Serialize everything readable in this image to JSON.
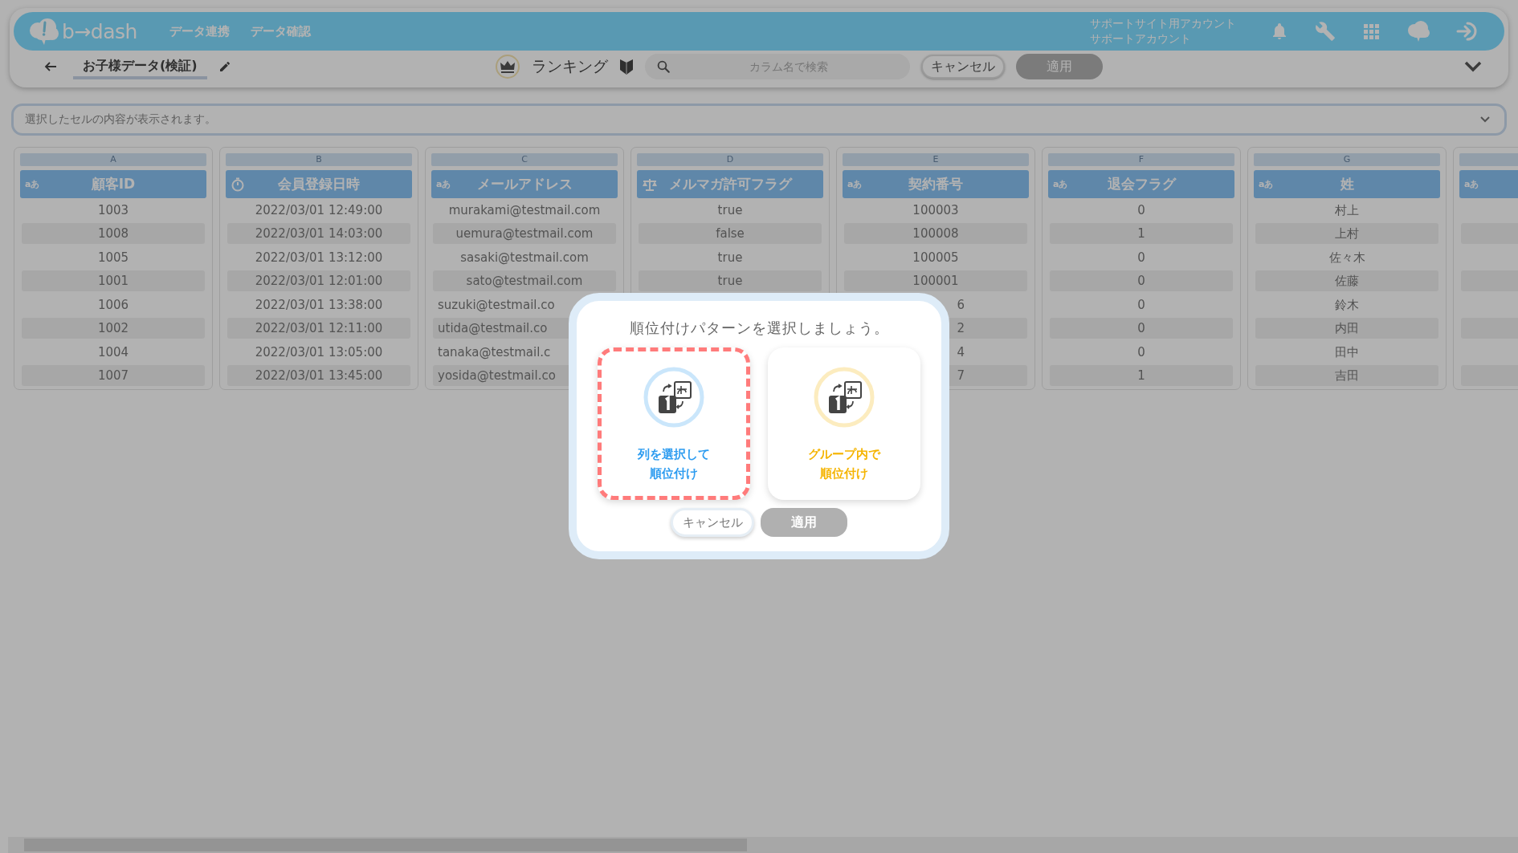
{
  "header": {
    "logo": "b→dash",
    "nav": [
      "データ連携",
      "データ確認"
    ],
    "account": [
      "サポートサイト用アカウント",
      "サポートアカウント"
    ]
  },
  "toolbar": {
    "title": "お子様データ(検証)",
    "mode": "ランキング",
    "search": {
      "placeholder": "カラム名で検索"
    },
    "cancel": "キャンセル",
    "apply": {
      "label": "適用",
      "disabled": true
    }
  },
  "cell_viewer": {
    "placeholder": "選択したセルの内容が表示されます。"
  },
  "columns": [
    {
      "letter": "A",
      "kind": "text",
      "type_label": "aあ",
      "title": "顧客ID",
      "cells": [
        {
          "value": "1003"
        },
        {
          "value": "1008"
        },
        {
          "value": "1005"
        },
        {
          "value": "1001"
        },
        {
          "value": "1006"
        },
        {
          "value": "1002"
        },
        {
          "value": "1004"
        },
        {
          "value": "1007"
        }
      ]
    },
    {
      "letter": "B",
      "kind": "datetime",
      "title": "会員登録日時",
      "cells": [
        {
          "value": "2022/03/01 12:49:00"
        },
        {
          "value": "2022/03/01 14:03:00"
        },
        {
          "value": "2022/03/01 13:12:00"
        },
        {
          "value": "2022/03/01 12:01:00"
        },
        {
          "value": "2022/03/01 13:38:00"
        },
        {
          "value": "2022/03/01 12:11:00"
        },
        {
          "value": "2022/03/01 13:05:00"
        },
        {
          "value": "2022/03/01 13:45:00"
        }
      ]
    },
    {
      "letter": "C",
      "kind": "text",
      "type_label": "aあ",
      "title": "メールアドレス",
      "cells": [
        {
          "value": "murakami@testmail.com"
        },
        {
          "value": "uemura@testmail.com"
        },
        {
          "value": "sasaki@testmail.com"
        },
        {
          "value": "sato@testmail.com"
        },
        {
          "value": "suzuki@testmail.co",
          "kind": "cut_end"
        },
        {
          "value": "utida@testmail.co",
          "kind": "cut_end"
        },
        {
          "value": "tanaka@testmail.c",
          "kind": "cut_end"
        },
        {
          "value": "yosida@testmail.co",
          "kind": "cut_end"
        }
      ]
    },
    {
      "letter": "D",
      "kind": "boolean",
      "title": "メルマガ許可フラグ",
      "cells": [
        {
          "value": "true"
        },
        {
          "value": "false"
        },
        {
          "value": "true"
        },
        {
          "value": "true"
        }
      ]
    },
    {
      "letter": "E",
      "kind": "text",
      "type_label": "aあ",
      "title": "契約番号",
      "cells": [
        {
          "value": "100003"
        },
        {
          "value": "100008"
        },
        {
          "value": "100005"
        },
        {
          "value": "100001"
        },
        {
          "value": "6",
          "kind": "cut_start"
        },
        {
          "value": "2",
          "kind": "cut_start"
        },
        {
          "value": "4",
          "kind": "cut_start"
        },
        {
          "value": "7",
          "kind": "cut_start"
        }
      ]
    },
    {
      "letter": "F",
      "kind": "text",
      "type_label": "aあ",
      "title": "退会フラグ",
      "cells": [
        {
          "value": "0"
        },
        {
          "value": "1"
        },
        {
          "value": "0"
        },
        {
          "value": "0"
        },
        {
          "value": "0"
        },
        {
          "value": "0"
        },
        {
          "value": "0"
        },
        {
          "value": "1"
        }
      ]
    },
    {
      "letter": "G",
      "kind": "text",
      "type_label": "aあ",
      "title": "姓",
      "cells": [
        {
          "value": "村上"
        },
        {
          "value": "上村"
        },
        {
          "value": "佐々木"
        },
        {
          "value": "佐藤"
        },
        {
          "value": "鈴木"
        },
        {
          "value": "内田"
        },
        {
          "value": "田中"
        },
        {
          "value": "吉田"
        }
      ]
    },
    {
      "kind": "text",
      "type_label": "aあ",
      "cells": [
        {},
        {},
        {},
        {},
        {},
        {},
        {},
        {}
      ]
    }
  ],
  "dialog": {
    "title": "順位付けパターンを選択しましょう。",
    "options": [
      {
        "label_lines": [
          "列を選択して",
          "順位付け"
        ],
        "color": "#2d9cf0",
        "selected": true
      },
      {
        "label_lines": [
          "グループ内で",
          "順位付け"
        ],
        "color": "#f5b400",
        "selected": false
      }
    ],
    "cancel": "キャンセル",
    "apply": {
      "label": "適用",
      "disabled": true
    }
  }
}
